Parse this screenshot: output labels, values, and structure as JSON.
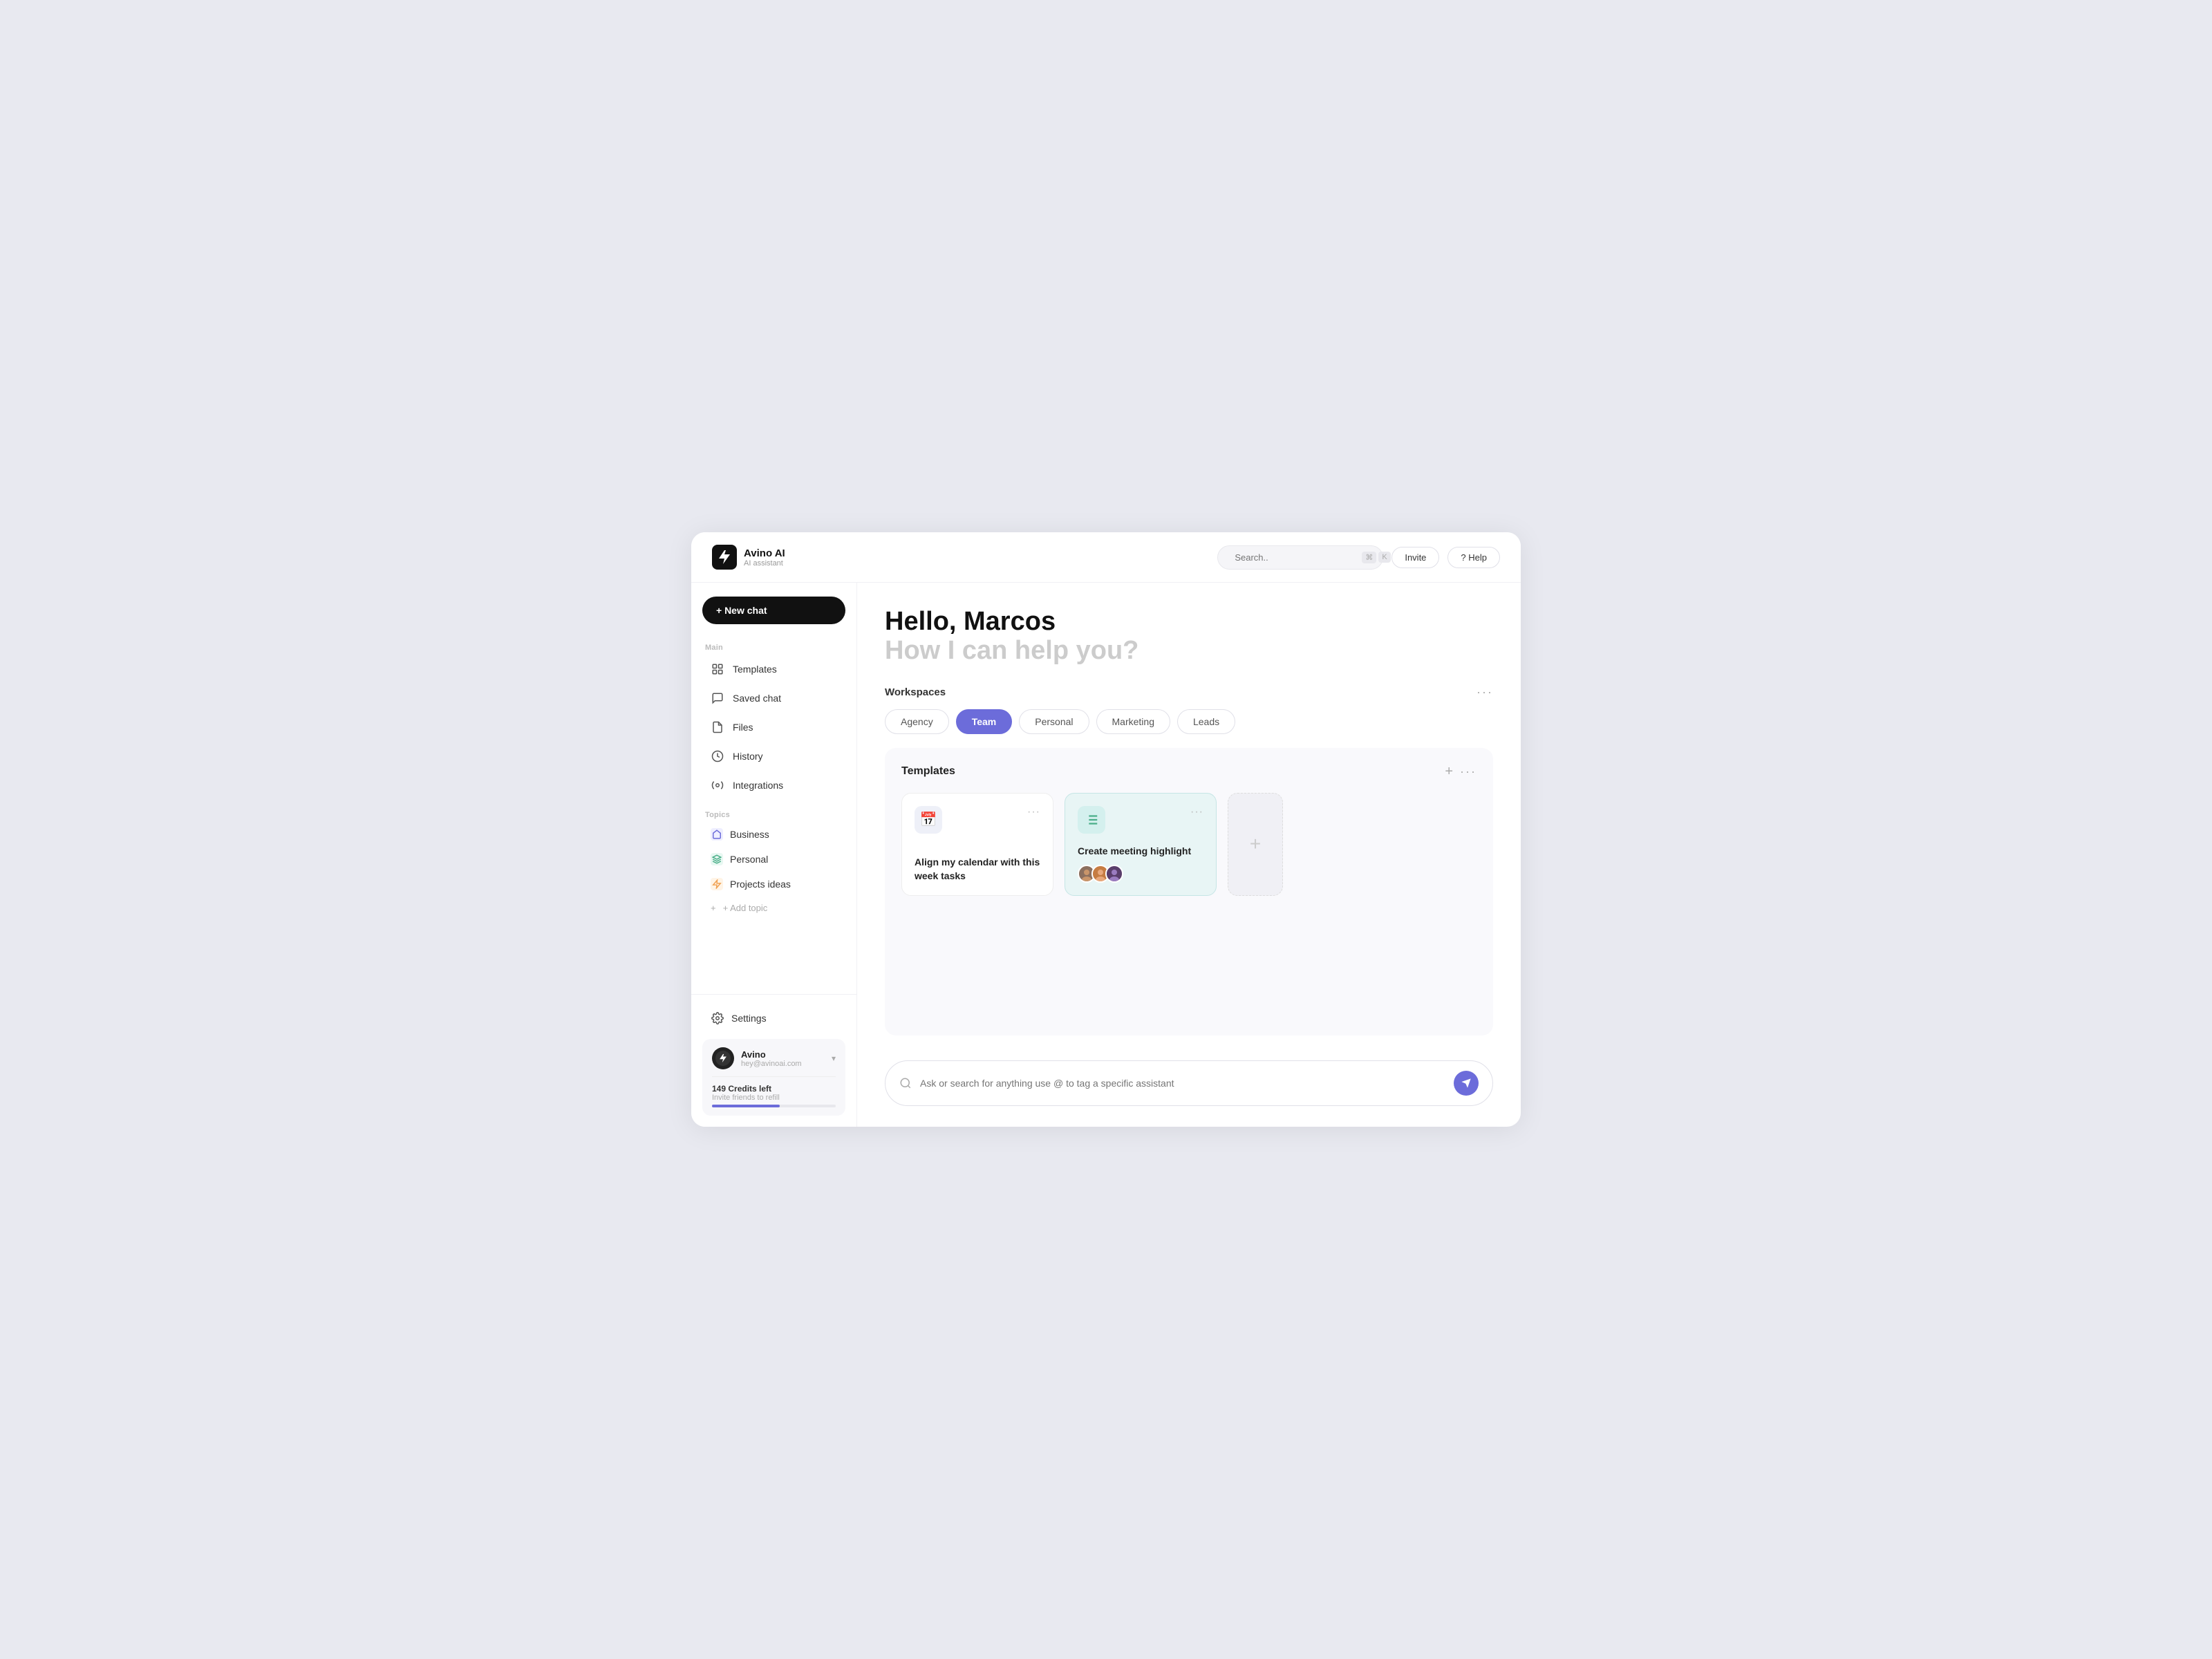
{
  "brand": {
    "name": "Avino AI",
    "sub": "AI assistant"
  },
  "topbar": {
    "search_placeholder": "Search..",
    "kbd_cmd": "⌘",
    "kbd_k": "K",
    "invite_label": "Invite",
    "help_label": "? Help"
  },
  "sidebar": {
    "new_chat": "+ New chat",
    "main_label": "Main",
    "nav_items": [
      {
        "id": "templates",
        "label": "Templates"
      },
      {
        "id": "saved-chat",
        "label": "Saved chat"
      },
      {
        "id": "files",
        "label": "Files"
      },
      {
        "id": "history",
        "label": "History"
      },
      {
        "id": "integrations",
        "label": "Integrations"
      }
    ],
    "topics_label": "Topics",
    "topics": [
      {
        "id": "business",
        "label": "Business",
        "color": "#6c6cda"
      },
      {
        "id": "personal",
        "label": "Personal",
        "color": "#4caf8a"
      },
      {
        "id": "projects-ideas",
        "label": "Projects ideas",
        "color": "#f0a050"
      }
    ],
    "add_topic": "+ Add topic",
    "settings_label": "Settings",
    "user": {
      "name": "Avino",
      "email": "hey@avinoai.com"
    },
    "credits": {
      "label": "149 Credits left",
      "sub": "Invite friends to refill",
      "percent": 55
    }
  },
  "main": {
    "greeting_hello": "Hello, Marcos",
    "greeting_sub": "How I can help you?",
    "workspaces": {
      "label": "Workspaces",
      "tabs": [
        {
          "id": "agency",
          "label": "Agency",
          "active": false
        },
        {
          "id": "team",
          "label": "Team",
          "active": true
        },
        {
          "id": "personal",
          "label": "Personal",
          "active": false
        },
        {
          "id": "marketing",
          "label": "Marketing",
          "active": false
        },
        {
          "id": "leads",
          "label": "Leads",
          "active": false
        }
      ]
    },
    "templates": {
      "label": "Templates",
      "cards": [
        {
          "id": "calendar",
          "title": "Align my calendar with this week tasks",
          "icon": "📅",
          "highlighted": false
        },
        {
          "id": "meeting",
          "title": "Create meeting highlight",
          "icon": "≡",
          "highlighted": true,
          "avatars": [
            "A",
            "B",
            "C"
          ]
        }
      ],
      "add_label": "+"
    },
    "chat_placeholder": "Ask or search for anything use @ to tag a specific assistant"
  }
}
